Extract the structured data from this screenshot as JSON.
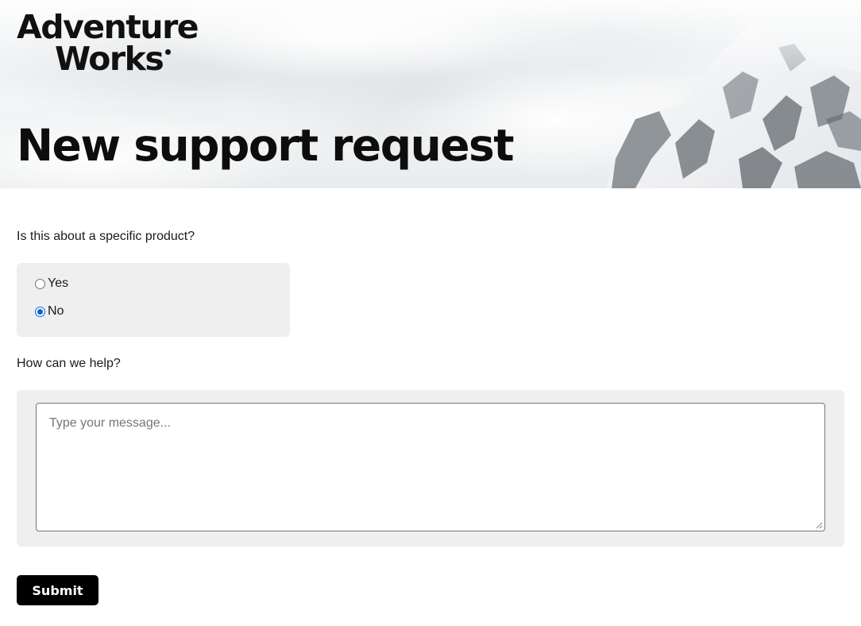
{
  "brand": {
    "logo_line1": "Adventure",
    "logo_line2": "Works"
  },
  "page": {
    "title": "New support request"
  },
  "form": {
    "product_question": "Is this about a specific product?",
    "product_options": [
      {
        "label": "Yes",
        "checked": false
      },
      {
        "label": "No",
        "checked": true
      }
    ],
    "help_question": "How can we help?",
    "message_value": "",
    "message_placeholder": "Type your message...",
    "submit_label": "Submit"
  },
  "colors": {
    "accent": "#0b63d9",
    "button_bg": "#000000",
    "panel_bg": "#efefef"
  }
}
